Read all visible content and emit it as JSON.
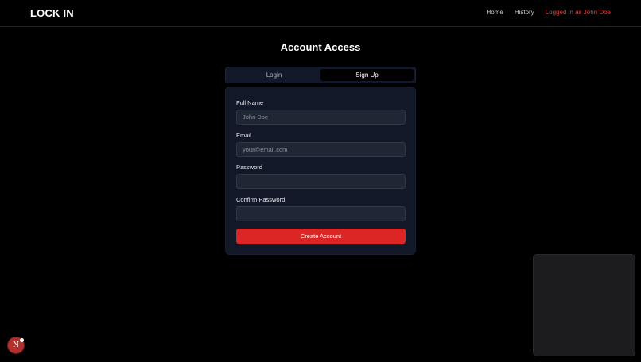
{
  "header": {
    "logo": "LOCK IN",
    "nav": {
      "home": "Home",
      "history": "History",
      "user_status": "Logged in as John Doe"
    }
  },
  "page": {
    "title": "Account Access"
  },
  "tabs": [
    {
      "label": "Login",
      "active": false
    },
    {
      "label": "Sign Up",
      "active": true
    }
  ],
  "form": {
    "full_name": {
      "label": "Full Name",
      "placeholder": "John Doe"
    },
    "email": {
      "label": "Email",
      "placeholder": "your@email.com"
    },
    "password": {
      "label": "Password",
      "placeholder": ""
    },
    "confirm_password": {
      "label": "Confirm Password",
      "placeholder": ""
    },
    "submit_label": "Create Account"
  },
  "badge": {
    "letter": "N"
  },
  "colors": {
    "accent": "#dc2626",
    "user_status": "#e23c3c",
    "card_bg": "#121827",
    "input_bg": "#1f2735"
  }
}
